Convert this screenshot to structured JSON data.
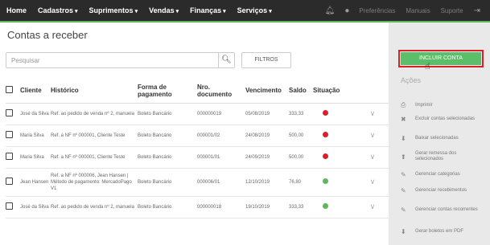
{
  "nav": {
    "items": [
      {
        "label": "Home",
        "caret": false
      },
      {
        "label": "Cadastros",
        "caret": true
      },
      {
        "label": "Suprimentos",
        "caret": true
      },
      {
        "label": "Vendas",
        "caret": true
      },
      {
        "label": "Finanças",
        "caret": true
      },
      {
        "label": "Serviços",
        "caret": true
      }
    ],
    "links": [
      "Preferências",
      "Manuais",
      "Suporte"
    ]
  },
  "page": {
    "title": "Contas a receber"
  },
  "search": {
    "placeholder": "Pesquisar",
    "filters_label": "FILTROS"
  },
  "table": {
    "headers": [
      "Cliente",
      "Histórico",
      "Forma de pagamento",
      "Nro. documento",
      "Vencimento",
      "Saldo",
      "Situação"
    ],
    "rows": [
      {
        "cliente": "José da Silva",
        "historico": "Ref. ao pedido de venda nº 2, manuela",
        "forma": "Boleto Bancário",
        "documento": "000000019",
        "vencimento": "05/08/2019",
        "saldo": "333,33",
        "status_color": "#d9202a"
      },
      {
        "cliente": "Maria Silva",
        "historico": "Ref. a NF nº 000001, Cliente Teste",
        "forma": "Boleto Bancário",
        "documento": "000001/02",
        "vencimento": "24/08/2019",
        "saldo": "500,00",
        "status_color": "#d9202a"
      },
      {
        "cliente": "Maria Silva",
        "historico": "Ref. a NF nº 000001, Cliente Teste",
        "forma": "Boleto Bancário",
        "documento": "000001/01",
        "vencimento": "24/09/2019",
        "saldo": "500,00",
        "status_color": "#d9202a"
      },
      {
        "cliente": "Jean Hansen",
        "historico": "Ref. a NF nº 000006, Jean Hansen | Método de pagamento: MercadoPago V1",
        "forma": "Boleto Bancário",
        "documento": "000006/01",
        "vencimento": "12/10/2019",
        "saldo": "76,80",
        "status_color": "#5cb85c"
      },
      {
        "cliente": "José da Silva",
        "historico": "Ref. ao pedido de venda nº 2, manuela",
        "forma": "Boleto Bancário",
        "documento": "000000018",
        "vencimento": "19/10/2019",
        "saldo": "333,33",
        "status_color": "#5cb85c"
      }
    ]
  },
  "sidebar": {
    "include_label": "INCLUIR CONTA",
    "actions_title": "Ações",
    "actions": [
      {
        "icon": "printer-icon",
        "label": "Imprimir"
      },
      {
        "icon": "trash-icon",
        "label": "Excluir contas selecionadas"
      },
      {
        "icon": "download-icon",
        "label": "Baixar selecionadas"
      },
      {
        "icon": "upload-icon",
        "label": "Gerar remessa dos selecionados"
      },
      {
        "icon": "edit-icon",
        "label": "Gerenciar categorias"
      },
      {
        "icon": "edit-icon",
        "label": "Gerenciar recebimentos"
      },
      {
        "icon": "edit-icon",
        "label": "Gerenciar contas recorrentes"
      },
      {
        "icon": "download-icon",
        "label": "Gerar boletos em PDF"
      }
    ]
  },
  "colors": {
    "accent": "#5cb85c",
    "danger": "#d9202a",
    "topbar": "#2b2b2b"
  }
}
